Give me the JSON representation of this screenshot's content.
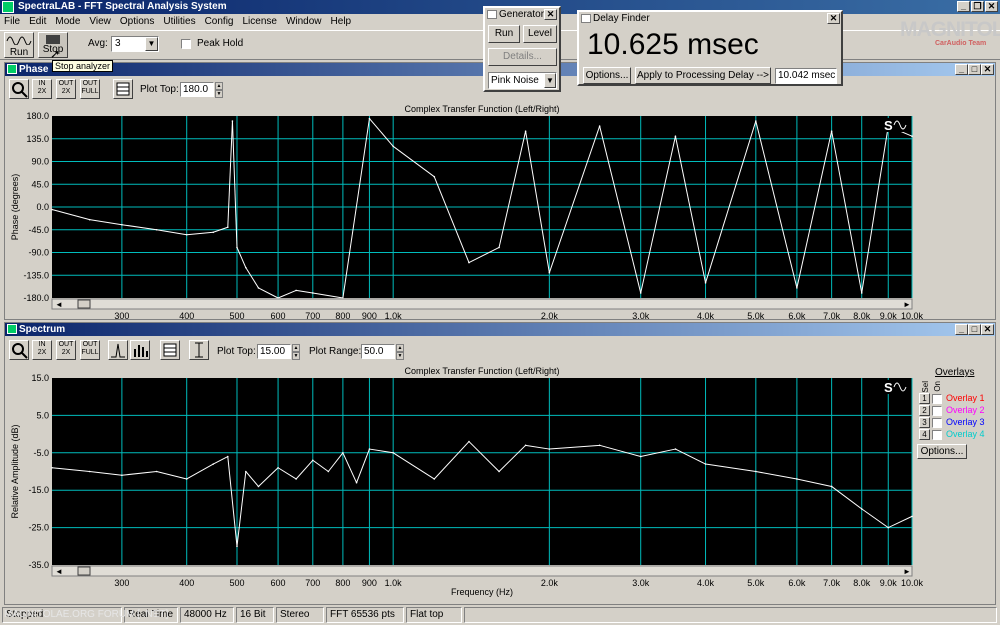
{
  "app": {
    "title": "SpectraLAB - FFT Spectral Analysis System"
  },
  "menu": [
    "File",
    "Edit",
    "Mode",
    "View",
    "Options",
    "Utilities",
    "Config",
    "License",
    "Window",
    "Help"
  ],
  "toolbar": {
    "run_label": "Run",
    "stop_label": "Stop",
    "tooltip": "Stop analyzer",
    "avg_label": "Avg:",
    "avg_value": "3",
    "peak_hold_label": "Peak Hold"
  },
  "generator": {
    "title": "Generator",
    "run": "Run",
    "level": "Level",
    "details": "Details...",
    "noise": "Pink Noise"
  },
  "delay_finder": {
    "title": "Delay Finder",
    "value": "10.625 msec",
    "options": "Options...",
    "apply": "Apply to Processing Delay -->",
    "field": "10.042 msec"
  },
  "watermark": {
    "brand": "MAGNITOLA",
    "sub": "CarAudio Team"
  },
  "phase": {
    "title": "Phase",
    "plot_top_label": "Plot Top:",
    "plot_top": "180.0",
    "plot_title": "Complex Transfer Function (Left/Right)",
    "ylabel": "Phase (degrees)"
  },
  "spectrum": {
    "title": "Spectrum",
    "plot_top_label": "Plot Top:",
    "plot_top": "15.00",
    "plot_range_label": "Plot Range:",
    "plot_range": "50.0",
    "plot_title": "Complex Transfer Function (Left/Right)",
    "ylabel": "Relative Amplitude (dB)",
    "xlabel": "Frequency (Hz)",
    "options": "Options..."
  },
  "overlays": {
    "title": "Overlays",
    "sel": "Sel",
    "on": "On",
    "items": [
      {
        "num": "1",
        "label": "Overlay 1",
        "color": "#ff0000"
      },
      {
        "num": "2",
        "label": "Overlay 2",
        "color": "#ff00ff"
      },
      {
        "num": "3",
        "label": "Overlay 3",
        "color": "#0000ff"
      },
      {
        "num": "4",
        "label": "Overlay 4",
        "color": "#00cccc"
      }
    ]
  },
  "x_ticks": [
    "300",
    "400",
    "500",
    "600",
    "700",
    "800",
    "900",
    "1.0k",
    "2.0k",
    "3.0k",
    "4.0k",
    "5.0k",
    "6.0k",
    "7.0k",
    "8.0k",
    "9.0k",
    "10.0k"
  ],
  "phase_y_ticks": [
    "180.0",
    "135.0",
    "90.0",
    "45.0",
    "0.0",
    "-45.0",
    "-90.0",
    "-135.0",
    "-180.0"
  ],
  "spec_y_ticks": [
    "15.0",
    "5.0",
    "-5.0",
    "-15.0",
    "-25.0",
    "-35.0"
  ],
  "status": {
    "s1": "Stopped",
    "s2": "Real Time",
    "s3": "48000 Hz",
    "s4": "16 Bit",
    "s5": "Stereo",
    "s6": "FFT 65536 pts",
    "s7": "Flat top"
  },
  "site": "MAGNITOLAE.ORG FORUM [ .NET]",
  "chart_data": [
    {
      "type": "line",
      "title": "Complex Transfer Function (Left/Right)",
      "ylabel": "Phase (degrees)",
      "xlabel": "",
      "x_scale": "log",
      "xlim": [
        220,
        10000
      ],
      "ylim": [
        -180,
        180
      ],
      "series": [
        {
          "x": [
            220,
            260,
            300,
            350,
            400,
            450,
            480,
            490,
            500,
            520,
            550,
            600,
            650,
            700,
            800,
            900,
            1000,
            1200,
            1400,
            1600,
            1800,
            2000,
            2500,
            3000,
            3500,
            4000,
            5000,
            6000,
            7000,
            8000,
            9000,
            10000
          ],
          "y": [
            -5,
            -25,
            -35,
            -45,
            -55,
            -50,
            -40,
            170,
            -80,
            -120,
            -160,
            -180,
            -165,
            -170,
            -180,
            175,
            120,
            60,
            -110,
            -80,
            150,
            -130,
            160,
            -170,
            140,
            -150,
            170,
            -160,
            150,
            -170,
            160,
            140
          ]
        }
      ]
    },
    {
      "type": "line",
      "title": "Complex Transfer Function (Left/Right)",
      "ylabel": "Relative Amplitude (dB)",
      "xlabel": "Frequency (Hz)",
      "x_scale": "log",
      "xlim": [
        220,
        10000
      ],
      "ylim": [
        -35,
        15
      ],
      "series": [
        {
          "x": [
            220,
            260,
            300,
            350,
            400,
            450,
            480,
            500,
            520,
            550,
            600,
            650,
            700,
            750,
            800,
            850,
            900,
            1000,
            1200,
            1400,
            1600,
            1800,
            2000,
            2500,
            3000,
            3500,
            4000,
            5000,
            6000,
            7000,
            8000,
            9000,
            10000
          ],
          "y": [
            -9,
            -10,
            -11,
            -10,
            -12,
            -8,
            -6,
            -30,
            -10,
            -14,
            -9,
            -12,
            -7,
            -10,
            -5,
            -13,
            -4,
            -5,
            -12,
            -2,
            -10,
            -3,
            -4,
            -3,
            -6,
            -4,
            -8,
            -10,
            -12,
            -14,
            -20,
            -25,
            -22
          ]
        }
      ]
    }
  ]
}
